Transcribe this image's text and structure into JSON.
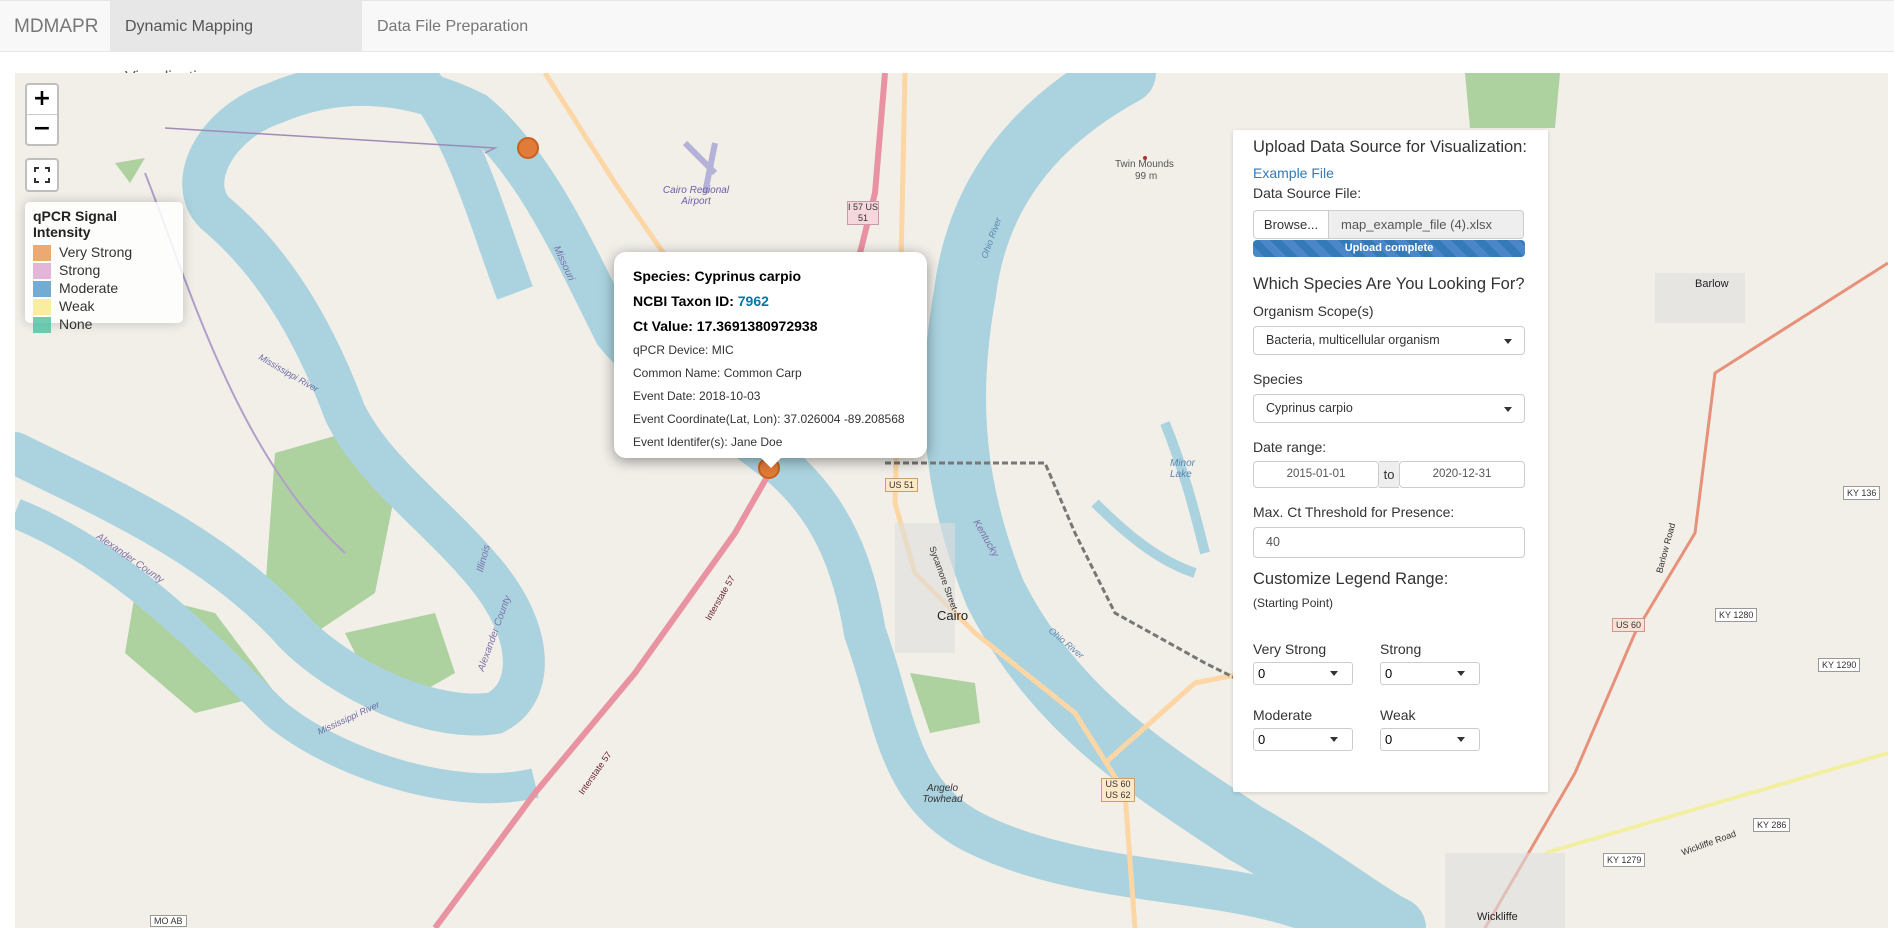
{
  "navbar": {
    "brand": "MDMAPR",
    "tabs": [
      {
        "label": "Dynamic Mapping Visualization",
        "active": true
      },
      {
        "label": "Data File Preparation",
        "active": false
      }
    ]
  },
  "map": {
    "zoom_in": "+",
    "zoom_out": "−",
    "legend": {
      "title": "qPCR Signal Intensity",
      "items": [
        {
          "label": "Very Strong",
          "color": "#e8934f"
        },
        {
          "label": "Strong",
          "color": "#dca4cf"
        },
        {
          "label": "Moderate",
          "color": "#4f96c9"
        },
        {
          "label": "Weak",
          "color": "#f6ea87"
        },
        {
          "label": "None",
          "color": "#4fbfa3"
        }
      ]
    },
    "popup": {
      "species_label": "Species:",
      "species": "Cyprinus carpio",
      "taxon_label": "NCBI Taxon ID:",
      "taxon_id": "7962",
      "ct_label": "Ct Value:",
      "ct_value": "17.3691380972938",
      "device": "qPCR Device: MIC",
      "common_name": "Common Name: Common Carp",
      "event_date": "Event Date: 2018-10-03",
      "coords": "Event Coordinate(Lat, Lon): 37.026004 -89.208568",
      "identifier": "Event Identifer(s): Jane Doe"
    },
    "labels": {
      "airport": "Cairo Regional Airport",
      "twin_mounds": "Twin Mounds",
      "twin_mounds_elev": "99 m",
      "cairo": "Cairo",
      "barlow": "Barlow",
      "wickliffe": "Wickliffe",
      "angelo": "Angelo Towhead",
      "minor_lake": "Minor Lake",
      "i57_us51": "I 57 US 51",
      "us51": "US 51",
      "us60": "US 60",
      "us60_62": "US 60 US 62",
      "ky1280": "KY 1280",
      "ky1290": "KY 1290",
      "ky136": "KY 136",
      "ky286": "KY 286",
      "ky1279": "KY 1279",
      "mo_ab": "MO AB",
      "mississippi_river": "Mississippi River",
      "ohio_river": "Ohio River",
      "alexander_county": "Alexander County",
      "illinois": "Illinois",
      "missouri": "Missouri",
      "kentucky": "Kentucky",
      "interstate57": "Interstate 57",
      "sycamore": "Sycamore Street",
      "barlow_road": "Barlow Road",
      "wickliffe_road": "Wickliffe Road"
    }
  },
  "panel": {
    "upload_title": "Upload Data Source for Visualization:",
    "example_link": "Example File",
    "data_source_label": "Data Source File:",
    "browse_label": "Browse...",
    "file_name": "map_example_file (4).xlsx",
    "upload_status": "Upload complete",
    "upload_progress": 1.0,
    "species_title": "Which Species Are You Looking For?",
    "organism_scope_label": "Organism Scope(s)",
    "organism_scope_value": "Bacteria, multicellular organism",
    "species_label": "Species",
    "species_value": "Cyprinus carpio",
    "date_range_label": "Date range:",
    "date_start": "2015-01-01",
    "date_sep": "to",
    "date_end": "2020-12-31",
    "ct_threshold_label": "Max. Ct Threshold for Presence:",
    "ct_threshold_value": "40",
    "legend_range_title": "Customize Legend Range:",
    "legend_range_sub": "(Starting Point)",
    "very_strong_label": "Very Strong",
    "very_strong_value": "0",
    "strong_label": "Strong",
    "strong_value": "0",
    "moderate_label": "Moderate",
    "moderate_value": "0",
    "weak_label": "Weak",
    "weak_value": "0"
  }
}
